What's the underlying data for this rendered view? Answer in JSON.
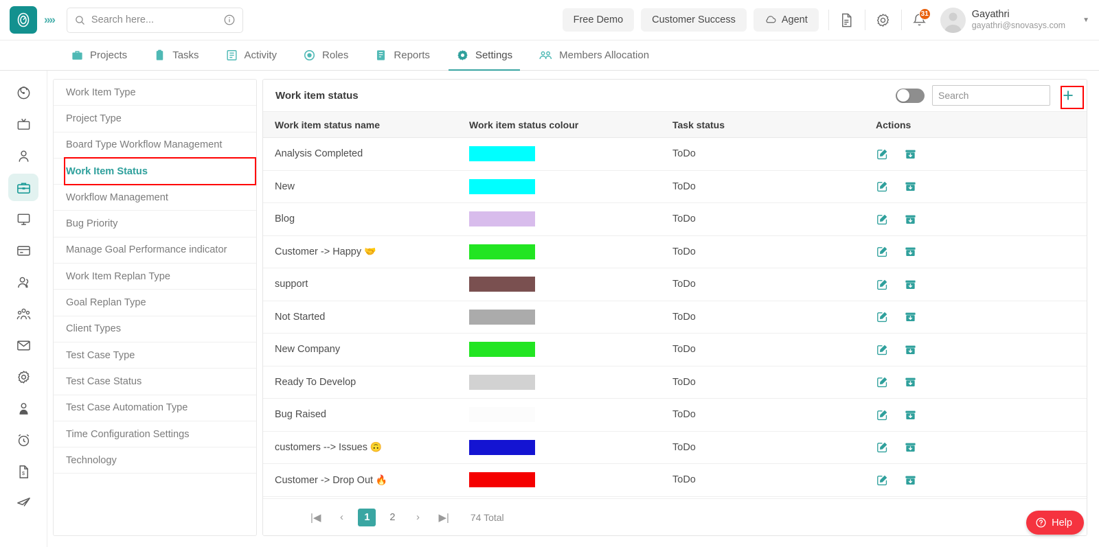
{
  "topbar": {
    "logo_icon": "clock-logo-icon",
    "expand_icon": "chevron-double-right-icon",
    "search": {
      "placeholder": "Search here...",
      "value": "",
      "icon": "search-icon",
      "info_icon": "info-circle-icon"
    },
    "buttons": [
      {
        "label": "Free Demo",
        "name": "free-demo-button",
        "icon": ""
      },
      {
        "label": "Customer Success",
        "name": "customer-success-button",
        "icon": ""
      },
      {
        "label": "Agent",
        "name": "agent-button",
        "icon": "cloud-icon"
      }
    ],
    "icons": [
      {
        "name": "document-icon"
      },
      {
        "name": "gear-icon"
      },
      {
        "name": "bell-icon",
        "badge": "31"
      }
    ],
    "user": {
      "name": "Gayathri",
      "email": "gayathri@snovasys.com",
      "avatar_icon": "avatar-icon",
      "caret_icon": "chevron-down-icon"
    }
  },
  "nav": {
    "tabs": [
      {
        "label": "Projects",
        "icon": "briefcase-icon",
        "active": false
      },
      {
        "label": "Tasks",
        "icon": "clipboard-icon",
        "active": false
      },
      {
        "label": "Activity",
        "icon": "list-icon",
        "active": false
      },
      {
        "label": "Roles",
        "icon": "target-icon",
        "active": false
      },
      {
        "label": "Reports",
        "icon": "report-icon",
        "active": false
      },
      {
        "label": "Settings",
        "icon": "gear-icon",
        "active": true
      },
      {
        "label": "Members Allocation",
        "icon": "members-icon",
        "active": false
      }
    ]
  },
  "rail": {
    "items": [
      {
        "icon": "dashboard-target-icon",
        "active": false
      },
      {
        "icon": "tv-board-icon",
        "active": false
      },
      {
        "icon": "person-icon",
        "active": false
      },
      {
        "icon": "briefcase-icon",
        "active": true
      },
      {
        "icon": "monitor-icon",
        "active": false
      },
      {
        "icon": "credit-card-icon",
        "active": false
      },
      {
        "icon": "users-icon",
        "active": false
      },
      {
        "icon": "team-icon",
        "active": false
      },
      {
        "icon": "mail-icon",
        "active": false
      },
      {
        "icon": "gear-icon",
        "active": false
      },
      {
        "icon": "admin-user-icon",
        "active": false
      },
      {
        "icon": "alarm-clock-icon",
        "active": false
      },
      {
        "icon": "invoice-icon",
        "active": false
      },
      {
        "icon": "send-icon",
        "active": false
      }
    ]
  },
  "subnav": {
    "items": [
      {
        "label": "Work Item Type",
        "selected": false
      },
      {
        "label": "Project Type",
        "selected": false
      },
      {
        "label": "Board Type Workflow Management",
        "selected": false
      },
      {
        "label": "Work Item Status",
        "selected": true
      },
      {
        "label": "Workflow Management",
        "selected": false
      },
      {
        "label": "Bug Priority",
        "selected": false
      },
      {
        "label": "Manage Goal Performance indicator",
        "selected": false
      },
      {
        "label": "Work Item Replan Type",
        "selected": false
      },
      {
        "label": "Goal Replan Type",
        "selected": false
      },
      {
        "label": "Client Types",
        "selected": false
      },
      {
        "label": "Test Case Type",
        "selected": false
      },
      {
        "label": "Test Case Status",
        "selected": false
      },
      {
        "label": "Test Case Automation Type",
        "selected": false
      },
      {
        "label": "Time Configuration Settings",
        "selected": false
      },
      {
        "label": "Technology",
        "selected": false
      }
    ]
  },
  "card": {
    "title": "Work item status",
    "toggle": {
      "name": "status-toggle",
      "on": false
    },
    "search": {
      "placeholder": "Search",
      "value": ""
    },
    "add_button": {
      "label": "+",
      "name": "add-work-item-status-button"
    },
    "columns": [
      "Work item status name",
      "Work item status colour",
      "Task status",
      "Actions"
    ],
    "rows": [
      {
        "name": "Analysis Completed",
        "emoji": "",
        "colour": "#00FFFF",
        "task_status": "ToDo"
      },
      {
        "name": "New",
        "emoji": "",
        "colour": "#00FFFF",
        "task_status": "ToDo"
      },
      {
        "name": "Blog",
        "emoji": "",
        "colour": "#D8BCEC",
        "task_status": "ToDo"
      },
      {
        "name": "Customer -> Happy",
        "emoji": "🤝",
        "colour": "#22E522",
        "task_status": "ToDo"
      },
      {
        "name": "support",
        "emoji": "",
        "colour": "#7A5050",
        "task_status": "ToDo"
      },
      {
        "name": "Not Started",
        "emoji": "",
        "colour": "#ABABAB",
        "task_status": "ToDo"
      },
      {
        "name": "New Company",
        "emoji": "",
        "colour": "#22E522",
        "task_status": "ToDo"
      },
      {
        "name": "Ready To Develop",
        "emoji": "",
        "colour": "#D2D2D2",
        "task_status": "ToDo"
      },
      {
        "name": "Bug Raised",
        "emoji": "",
        "colour": "#FCFCFC",
        "task_status": "ToDo"
      },
      {
        "name": "customers --> Issues",
        "emoji": "🙃",
        "colour": "#1414D2",
        "task_status": "ToDo"
      },
      {
        "name": "Customer -> Drop Out",
        "emoji": "🔥",
        "colour": "#F50000",
        "task_status": "ToDo"
      }
    ],
    "row_actions": [
      {
        "icon": "edit-icon"
      },
      {
        "icon": "archive-download-icon"
      }
    ]
  },
  "pagination": {
    "first": "|◀",
    "prev": "‹",
    "pages": [
      "1",
      "2"
    ],
    "active_page": "1",
    "next": "›",
    "last": "▶|",
    "total": "74 Total"
  },
  "help": {
    "label": "Help",
    "icon": "question-circle-icon"
  },
  "colors": {
    "accent": "#3aa6a2",
    "logo": "#13918f",
    "highlight": "#ff0000",
    "badge": "#e8620f",
    "help": "#f5333f"
  }
}
